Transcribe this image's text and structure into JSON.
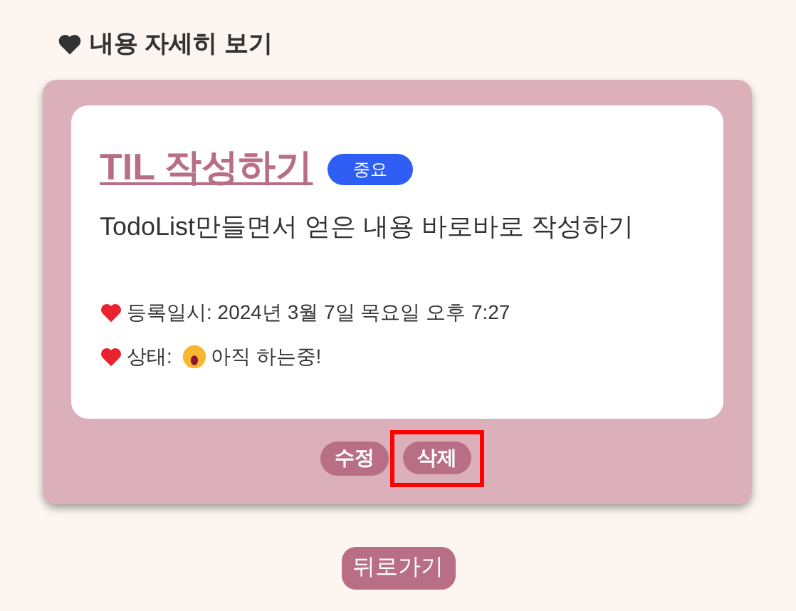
{
  "heading": "내용 자세히 보기",
  "todo": {
    "title": "TIL 작성하기",
    "badge": "중요",
    "description": "TodoList만들면서 얻은 내용 바로바로 작성하기",
    "meta": [
      {
        "kind": "date",
        "text": "등록일시: 2024년 3월 7일 목요일 오후 7:27"
      },
      {
        "kind": "status",
        "text": "상태:",
        "value": "아직 하는중!"
      }
    ]
  },
  "actions": [
    {
      "label": "수정",
      "highlighted": false
    },
    {
      "label": "삭제",
      "highlighted": true
    }
  ],
  "back_button": "뒤로가기"
}
